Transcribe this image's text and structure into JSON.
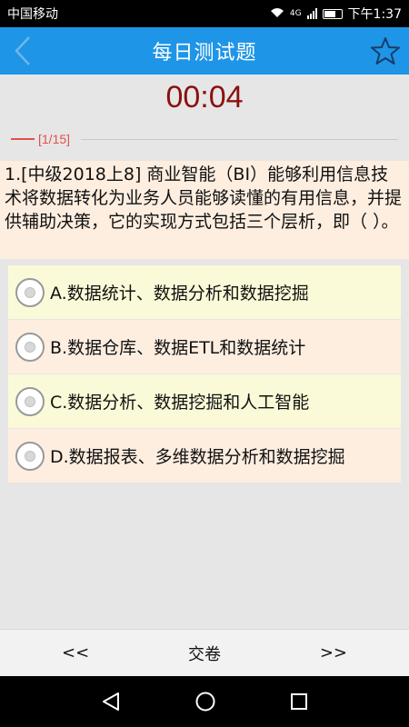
{
  "status_bar": {
    "carrier": "中国移动",
    "network": "4G",
    "time": "下午1:37"
  },
  "header": {
    "title": "每日测试题",
    "back_icon": "chevron-left-icon",
    "star_icon": "star-outline-icon"
  },
  "timer": "00:04",
  "progress": "[1/15]",
  "question": {
    "text": "1.[中级2018上8] 商业智能（BI）能够利用信息技术将数据转化为业务人员能够读懂的有用信息，并提供辅助决策，它的实现方式包括三个层析，即（ ）。"
  },
  "options": [
    {
      "label": "A.数据统计、数据分析和数据挖掘"
    },
    {
      "label": "B.数据仓库、数据ETL和数据统计"
    },
    {
      "label": "C.数据分析、数据挖掘和人工智能"
    },
    {
      "label": "D.数据报表、多维数据分析和数据挖掘"
    }
  ],
  "toolbar": {
    "prev": "<<",
    "submit": "交卷",
    "next": ">>"
  },
  "colors": {
    "header_bg": "#1e95e6",
    "timer": "#8b1010",
    "progress": "#e0524a"
  }
}
